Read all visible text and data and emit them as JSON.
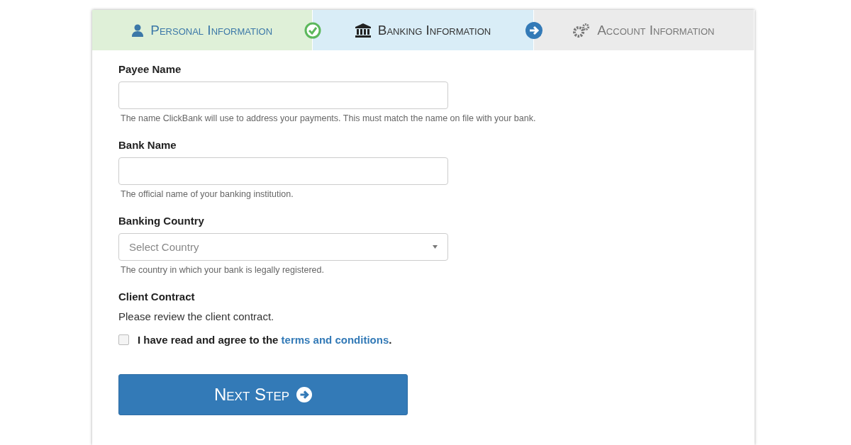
{
  "steps": [
    {
      "label": "Personal Information",
      "completed": true,
      "selected": false
    },
    {
      "label": "Banking Information",
      "completed": false,
      "selected": true
    },
    {
      "label": "Account Information",
      "completed": false,
      "selected": false
    }
  ],
  "fields": [
    {
      "kind": "text",
      "label": "Payee Name",
      "help": "The name ClickBank will use to address your payments. This must match the name on file with your bank."
    },
    {
      "kind": "text",
      "label": "Bank Name",
      "help": "The official name of your banking institution."
    },
    {
      "kind": "select",
      "label": "Banking Country",
      "placeholder": "Select Country",
      "help": "The country in which your bank is legally registered."
    }
  ],
  "contract": {
    "label": "Client Contract",
    "note": "Please review the client contract.",
    "checked": false,
    "text_before": "I have read and agree to the ",
    "link": "terms and conditions",
    "text_after": "."
  },
  "next_button": "Next Step"
}
